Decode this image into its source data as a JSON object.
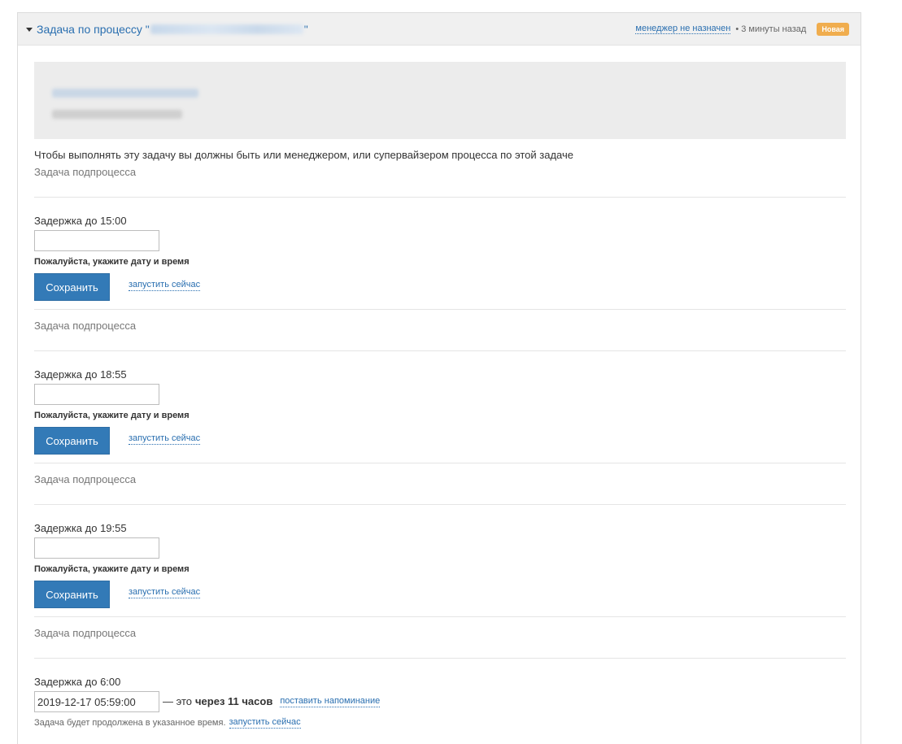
{
  "header": {
    "title_prefix": "Задача по процессу \"",
    "title_suffix": "\"",
    "manager_link": "менеджер не назначен",
    "separator": "•",
    "time_ago": "3 минуты назад",
    "status_badge": "Новая",
    "status_color": "#f0ad4e"
  },
  "notice": "Чтобы выполнять эту задачу вы должны быть или менеджером, или супервайзером процесса по этой задаче",
  "subprocess_label": "Задача подпроцесса",
  "tasks": [
    {
      "delay_title": "Задержка до 15:00",
      "input_value": "",
      "hint": "Пожалуйста, укажите дату и время",
      "save_label": "Сохранить",
      "run_now_label": "запустить сейчас"
    },
    {
      "delay_title": "Задержка до 18:55",
      "input_value": "",
      "hint": "Пожалуйста, укажите дату и время",
      "save_label": "Сохранить",
      "run_now_label": "запустить сейчас"
    },
    {
      "delay_title": "Задержка до 19:55",
      "input_value": "",
      "hint": "Пожалуйста, укажите дату и время",
      "save_label": "Сохранить",
      "run_now_label": "запустить сейчас"
    }
  ],
  "last_task": {
    "delay_title": "Задержка до 6:00",
    "input_value": "2019-12-17 05:59:00",
    "relative_prefix": "— это",
    "relative_strong": "через 11 часов",
    "remind_label": "поставить напоминание",
    "footer_text": "Задача будет продолжена в указанное время.",
    "run_now_label": "запустить сейчас"
  },
  "colors": {
    "link": "#2a6fb0",
    "primary_button": "#337ab7"
  }
}
